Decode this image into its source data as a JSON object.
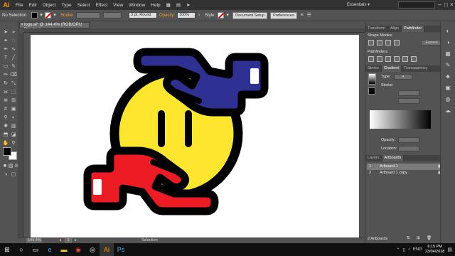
{
  "menubar": {
    "app_logo": "Ai",
    "menus": [
      "File",
      "Edit",
      "Object",
      "Type",
      "Select",
      "Effect",
      "View",
      "Window",
      "Help"
    ],
    "workspace": "Essentials"
  },
  "controlbar": {
    "selection_label": "No Selection",
    "stroke_label": "Stroke:",
    "brush_label": "3 pt. Round",
    "opacity_label": "Opacity:",
    "opacity_value": "100%",
    "style_label": "Style:",
    "doc_setup": "Document Setup",
    "preferences": "Preferences"
  },
  "document": {
    "tab_title": "logo.ai* @ 144.4% (RGB/GPU Preview)",
    "zoom": "144.4%",
    "artboard_number": "1",
    "status_tool": "Selection"
  },
  "panels": {
    "top_tabs": [
      "Transform",
      "Align",
      "Pathfinder"
    ],
    "top_active": "Pathfinder",
    "shape_modes_label": "Shape Modes:",
    "expand_label": "Expand",
    "pathfinders_label": "Pathfinders:",
    "grad_tabs": [
      "Stroke",
      "Gradient",
      "Transparency"
    ],
    "grad_active": "Gradient",
    "type_label": "Type:",
    "stroke_label": "Stroke:",
    "opacity_label": "Opacity:",
    "location_label": "Location:",
    "layer_tabs": [
      "Layers",
      "Artboards"
    ],
    "layer_active": "Artboards",
    "artboards": [
      {
        "num": "1",
        "name": "Artboard 1"
      },
      {
        "num": "2",
        "name": "Artboard 1 copy"
      }
    ],
    "artboard_count": "2 Artboards"
  },
  "taskbar": {
    "time": "6:15 PM",
    "date": "23/04/2018",
    "lang": "ENG"
  },
  "colors": {
    "yellow": "#ffe62e",
    "blue": "#2e3192",
    "red": "#ed1c24",
    "outline": "#000000",
    "accent": "#ff9a00"
  }
}
